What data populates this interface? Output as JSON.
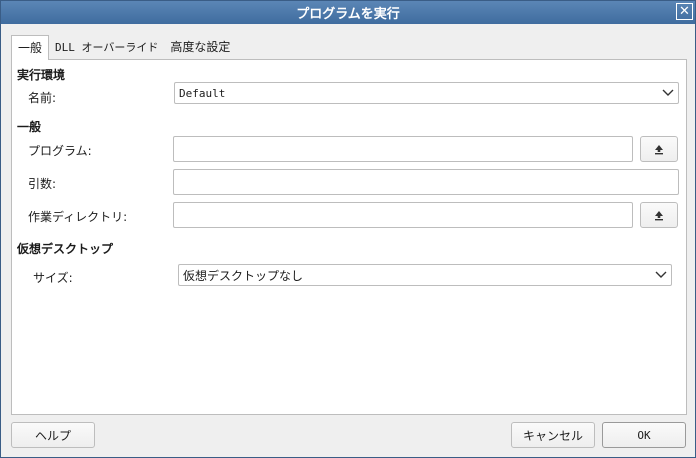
{
  "window": {
    "title": "プログラムを実行"
  },
  "tabs": [
    {
      "label": "一般"
    },
    {
      "label": "DLL オーバーライド"
    },
    {
      "label": "高度な設定"
    }
  ],
  "runtime": {
    "section_title": "実行環境",
    "name_label": "名前:",
    "name_value": "Default"
  },
  "general": {
    "section_title": "一般",
    "program_label": "プログラム:",
    "program_value": "",
    "args_label": "引数:",
    "args_value": "",
    "workdir_label": "作業ディレクトリ:",
    "workdir_value": ""
  },
  "virtual_desktop": {
    "section_title": "仮想デスクトップ",
    "size_label": "サイズ:",
    "size_value": "仮想デスクトップなし"
  },
  "footer": {
    "help_label": "ヘルプ",
    "cancel_label": "キャンセル",
    "ok_label": "OK"
  },
  "colors": {
    "titlebar": "#4a77a9",
    "panel": "#ffffff",
    "window_bg": "#efefef"
  },
  "icons": {
    "close": "close-icon",
    "upload": "upload-icon",
    "chevron": "chevron-down-icon"
  }
}
